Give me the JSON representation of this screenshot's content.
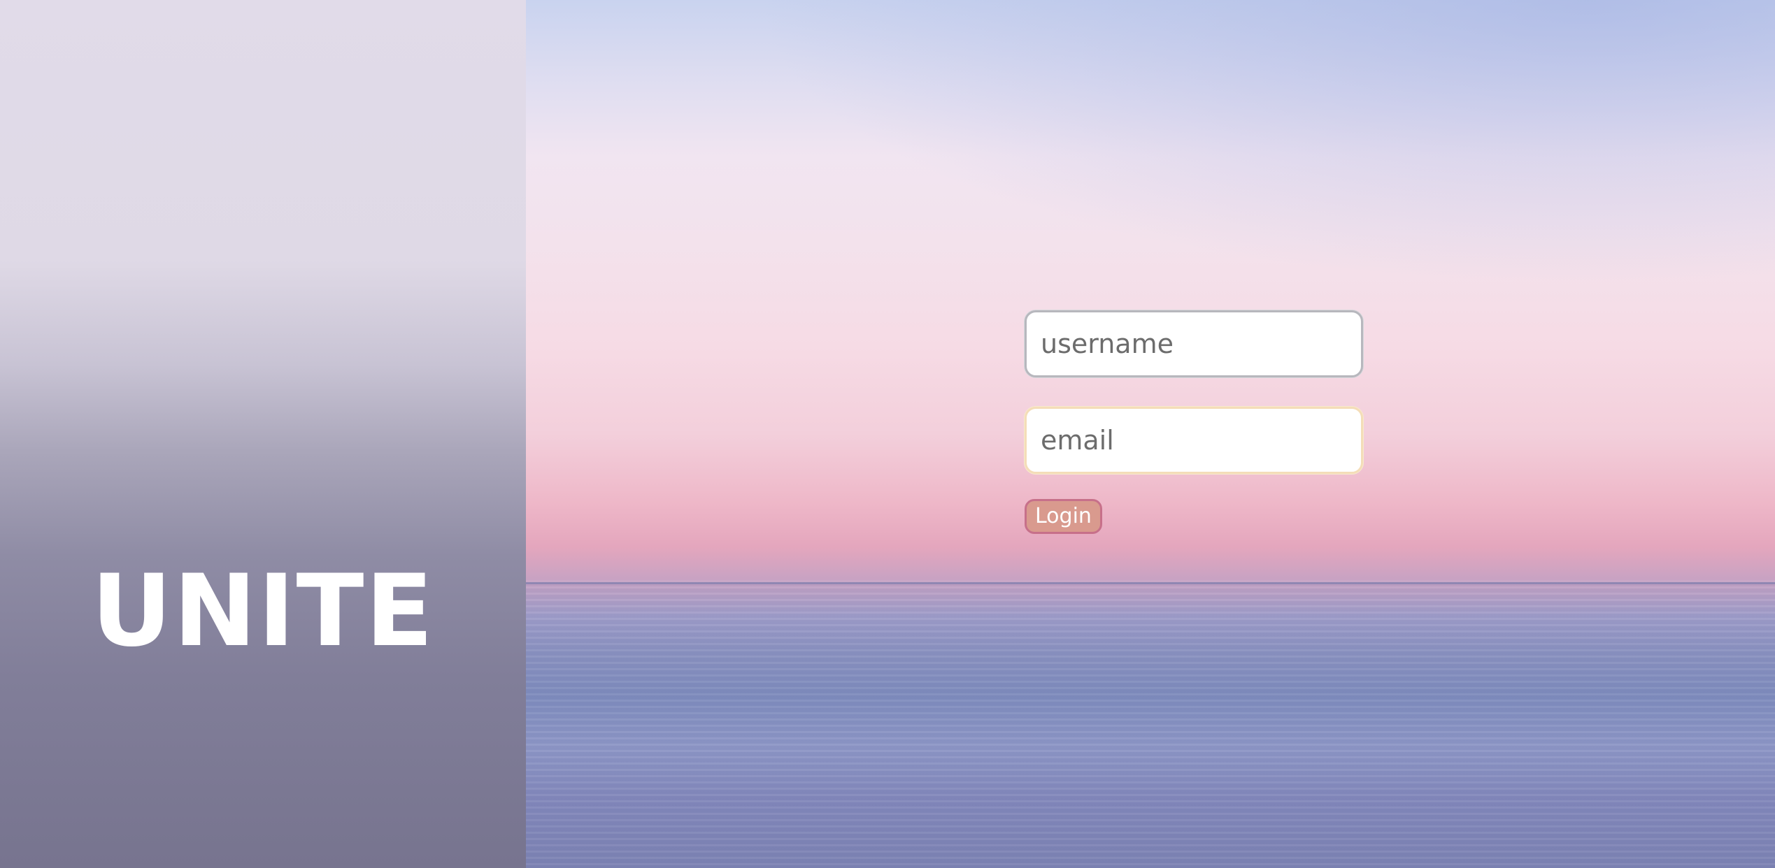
{
  "brand": {
    "title": "UNITE"
  },
  "login": {
    "username_placeholder": "username",
    "email_placeholder": "email",
    "button_label": "Login"
  },
  "colors": {
    "brand_text": "#ffffff",
    "button_bg": "#d99a8e",
    "button_border": "#c7708a",
    "email_border": "#f4ddb8"
  }
}
